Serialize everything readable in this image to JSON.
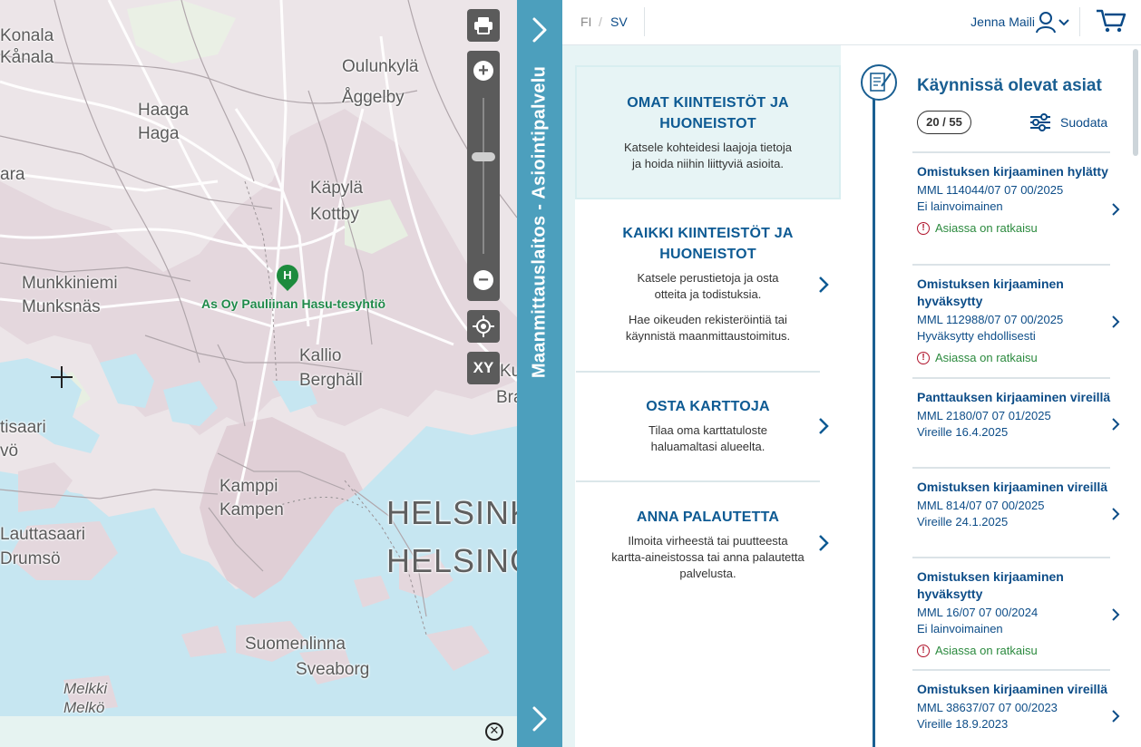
{
  "map": {
    "places": {
      "konala_fi": "Konala",
      "konala_sv": "Kånala",
      "oulunkyla_fi": "Oulunkylä",
      "oulunkyla_sv": "Åggelby",
      "haaga_fi": "Haaga",
      "haaga_sv": "Haga",
      "ara": "ara",
      "kapyla_fi": "Käpylä",
      "kapyla_sv": "Kottby",
      "munkkiniemi_fi": "Munkkiniemi",
      "munkkiniemi_sv": "Munksnäs",
      "kallio_fi": "Kallio",
      "kallio_sv": "Berghäll",
      "tisaari": "tisaari",
      "vo": "vö",
      "kamppi_fi": "Kamppi",
      "kamppi_sv": "Kampen",
      "lauttasaari_fi": "Lauttasaari",
      "lauttasaari_sv": "Drumsö",
      "helsinki_fi": "HELSINK",
      "helsinki_sv": "HELSING",
      "ku": "Ku",
      "bra": "Bra",
      "suomenlinna_fi": "Suomenlinna",
      "suomenlinna_sv": "Sveaborg",
      "melkki_fi": "Melkki",
      "melkki_sv": "Melkö"
    },
    "poi": {
      "letter": "H",
      "label": "As Oy Pauliinan Hasu-tesyhtiö"
    },
    "controls": {
      "xy_label": "XY",
      "zoom_in": "+",
      "zoom_out": "−",
      "zoom_level": 0.38
    },
    "footer_close": "✕"
  },
  "sidetab": {
    "title": "Maanmittauslaitos - Asiointipalvelu"
  },
  "header": {
    "lang_fi": "FI",
    "lang_sep": "/",
    "lang_sv": "SV",
    "user_name": "Jenna Maili"
  },
  "menu": {
    "items": [
      {
        "title": "OMAT KIINTEISTÖT JA HUONEISTOT",
        "desc": "Katsele kohteidesi laajoja tietoja ja hoida niihin liittyviä asioita.",
        "desc2": ""
      },
      {
        "title": "KAIKKI KIINTEISTÖT JA HUONEISTOT",
        "desc": "Katsele perustietoja ja osta otteita ja todistuksia.",
        "desc2": "Hae oikeuden rekisteröintiä tai käynnistä maanmittaustoimitus."
      },
      {
        "title": "OSTA KARTTOJA",
        "desc": "Tilaa oma karttatuloste haluamaltasi alueelta.",
        "desc2": ""
      },
      {
        "title": "ANNA PALAUTETTA",
        "desc": "Ilmoita virheestä tai puutteesta kartta-aineistossa tai anna palautetta palvelusta.",
        "desc2": ""
      }
    ]
  },
  "cases": {
    "title": "Käynnissä olevat asiat",
    "count": "20 / 55",
    "filter_label": "Suodata",
    "items": [
      {
        "title": "Omistuksen kirjaaminen hylätty",
        "id": "MML 114044/07 07 00/2025",
        "status": "Ei lainvoimainen",
        "decision": "Asiassa on ratkaisu"
      },
      {
        "title": "Omistuksen kirjaaminen hyväksytty",
        "id": "MML 112988/07 07 00/2025",
        "status": "Hyväksytty ehdollisesti",
        "decision": "Asiassa on ratkaisu"
      },
      {
        "title": "Panttauksen kirjaaminen vireillä",
        "id": "MML 2180/07 07 01/2025",
        "status": "Vireille 16.4.2025",
        "decision": ""
      },
      {
        "title": "Omistuksen kirjaaminen vireillä",
        "id": "MML 814/07 07 00/2025",
        "status": "Vireille 24.1.2025",
        "decision": ""
      },
      {
        "title": "Omistuksen kirjaaminen hyväksytty",
        "id": "MML 16/07 07 00/2024",
        "status": "Ei lainvoimainen",
        "decision": "Asiassa on ratkaisu"
      },
      {
        "title": "Omistuksen kirjaaminen vireillä",
        "id": "MML 38637/07 07 00/2023",
        "status": "Vireille 18.9.2023",
        "decision": ""
      }
    ]
  },
  "colors": {
    "accent": "#4c9fbd",
    "brand_blue": "#0d5a93",
    "success": "#2b8a3e",
    "warning": "#b0142c"
  }
}
